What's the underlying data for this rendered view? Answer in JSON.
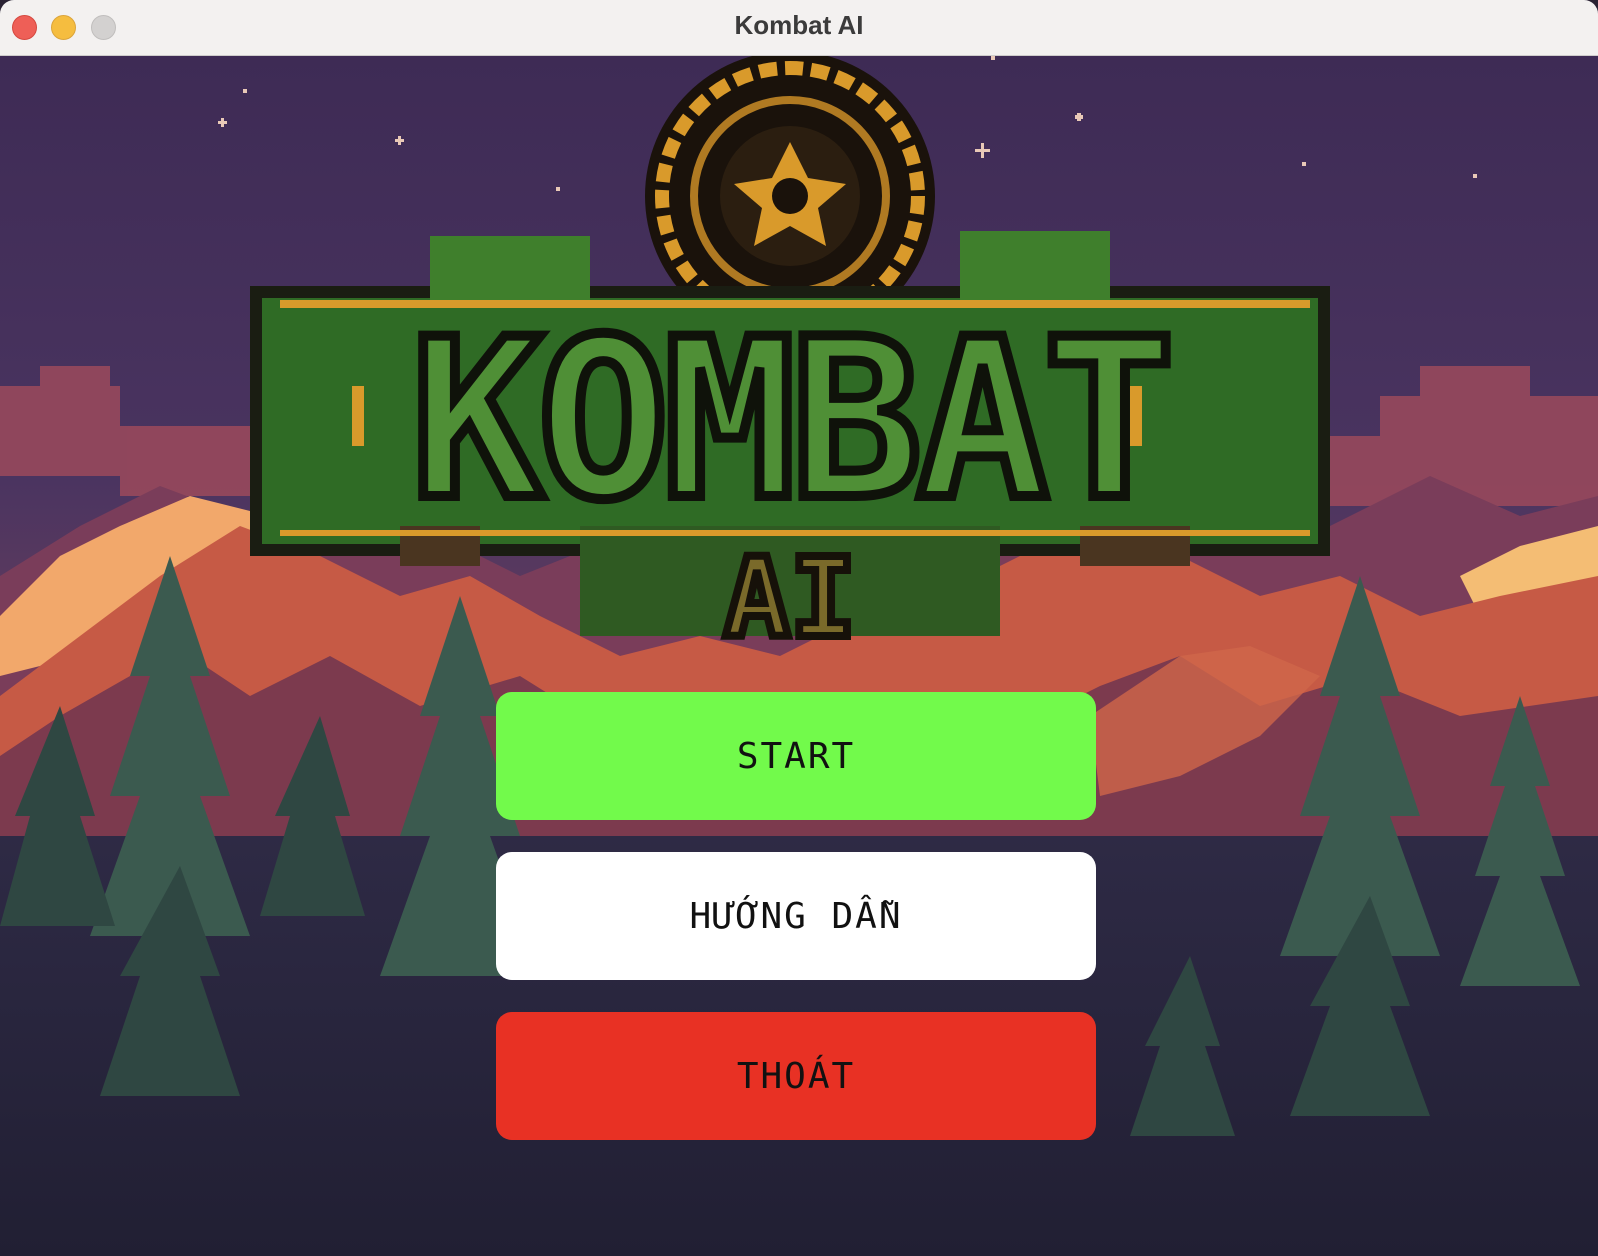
{
  "window": {
    "title": "Kombat AI"
  },
  "logo": {
    "main_text": "KOMBAT",
    "sub_text": "AI"
  },
  "menu": {
    "start_label": "START",
    "guide_label": "HƯỚNG DẪN",
    "quit_label": "THOÁT"
  },
  "colors": {
    "start_button": "#72fa4b",
    "guide_button": "#ffffff",
    "quit_button": "#e83124",
    "sky": "#3a2a52",
    "logo_green": "#3f7f2c",
    "logo_gold": "#d99a2b"
  },
  "icons": {
    "close": "close-icon",
    "minimize": "minimize-icon",
    "maximize": "maximize-icon"
  }
}
